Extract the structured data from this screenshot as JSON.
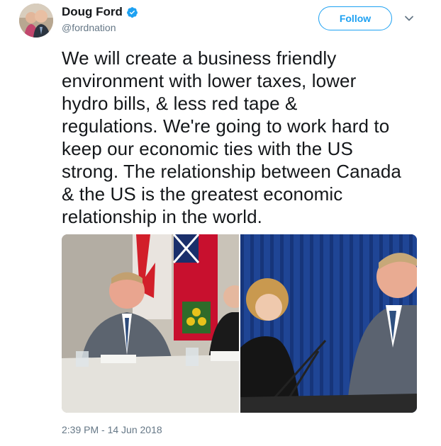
{
  "tweet": {
    "author_name": "Doug Ford",
    "author_handle": "@fordnation",
    "follow_label": "Follow",
    "text": "We will create a business friendly\nenvironment with lower taxes, lower\nhydro bills, & less red tape &\nregulations. We're going to work hard to\nkeep our economic ties with the US\nstrong. The relationship between Canada\n& the US is the greatest economic\nrelationship in the world.",
    "timestamp": "2:39 PM - 14 Jun 2018"
  },
  "icons": {
    "verified": "verified-badge-icon",
    "caret": "chevron-down-icon"
  },
  "colors": {
    "accent": "#1da1f2",
    "text": "#14171a",
    "muted": "#657786"
  }
}
